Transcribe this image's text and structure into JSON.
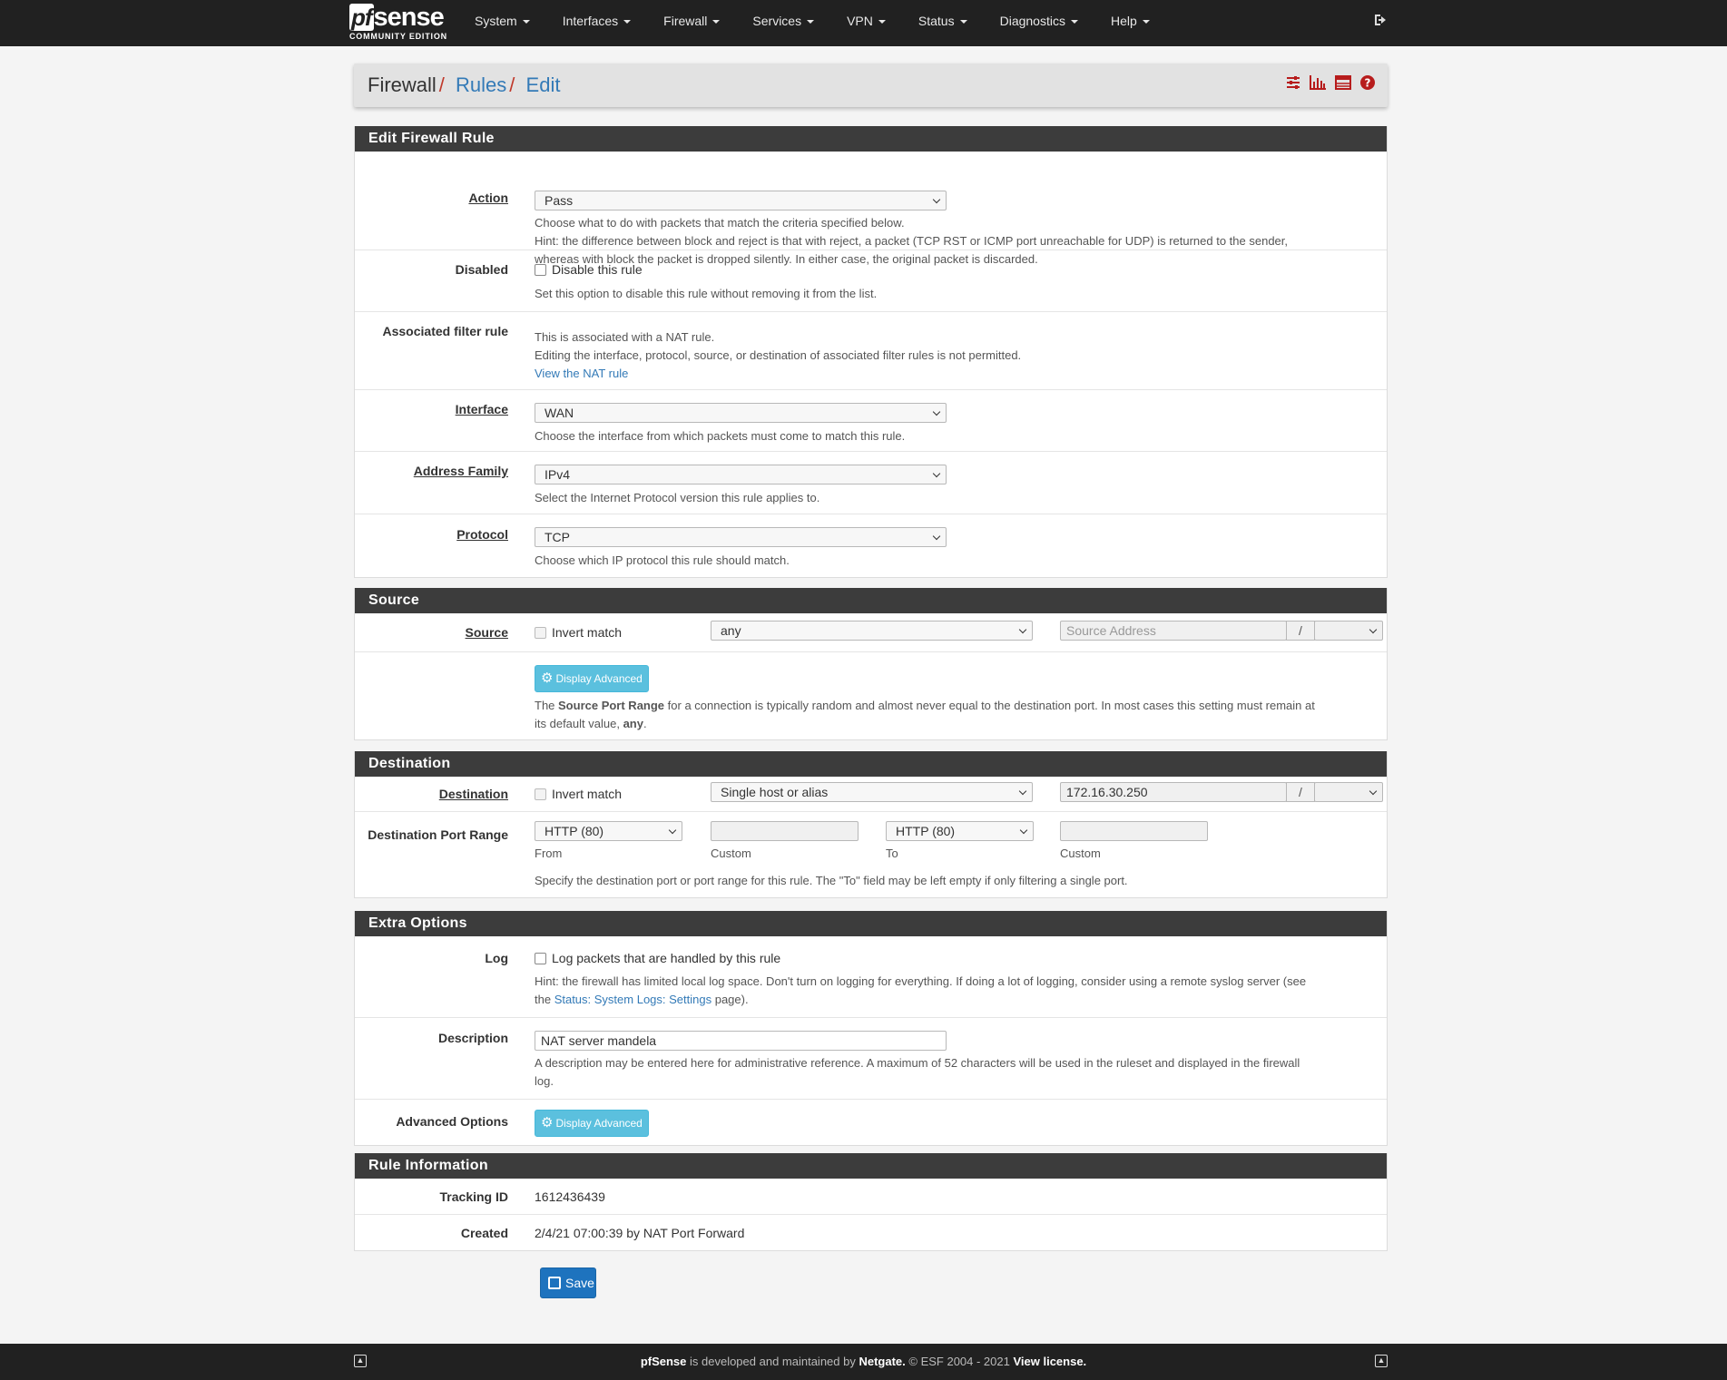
{
  "brand": {
    "logo_pf": "pf",
    "logo_sense": "sense",
    "edition": "COMMUNITY EDITION"
  },
  "nav": {
    "items": [
      {
        "label": "System"
      },
      {
        "label": "Interfaces"
      },
      {
        "label": "Firewall"
      },
      {
        "label": "Services"
      },
      {
        "label": "VPN"
      },
      {
        "label": "Status"
      },
      {
        "label": "Diagnostics"
      },
      {
        "label": "Help"
      }
    ]
  },
  "breadcrumb": {
    "root": "Firewall",
    "sep1": "/",
    "rules": "Rules",
    "sep2": "/",
    "edit": "Edit"
  },
  "header_icons": [
    "sliders-icon",
    "bar-chart-icon",
    "table-icon",
    "help-icon"
  ],
  "edit_rule": {
    "title": "Edit Firewall Rule",
    "action": {
      "label": "Action",
      "value": "Pass",
      "help1": "Choose what to do with packets that match the criteria specified below.",
      "help2": "Hint: the difference between block and reject is that with reject, a packet (TCP RST or ICMP port unreachable for UDP) is returned to the sender,",
      "help3": "whereas with block the packet is dropped silently. In either case, the original packet is discarded."
    },
    "disabled": {
      "label": "Disabled",
      "checkbox_label": "Disable this rule",
      "help": "Set this option to disable this rule without removing it from the list."
    },
    "assoc": {
      "label": "Associated filter rule",
      "line1": "This is associated with a NAT rule.",
      "line2": "Editing the interface, protocol, source, or destination of associated filter rules is not permitted.",
      "link": "View the NAT rule"
    },
    "interface": {
      "label": "Interface",
      "value": "WAN",
      "help": "Choose the interface from which packets must come to match this rule."
    },
    "family": {
      "label": "Address Family",
      "value": "IPv4",
      "help": "Select the Internet Protocol version this rule applies to."
    },
    "protocol": {
      "label": "Protocol",
      "value": "TCP",
      "help": "Choose which IP protocol this rule should match."
    }
  },
  "source": {
    "title": "Source",
    "label": "Source",
    "invert": "Invert match",
    "type": "any",
    "address_placeholder": "Source Address",
    "slash": "/",
    "advanced_btn": "Display Advanced",
    "help_pre": "The ",
    "help_bold": "Source Port Range",
    "help_mid": " for a connection is typically random and almost never equal to the destination port. In most cases this setting must remain at",
    "help_line2_pre": "its default value, ",
    "help_line2_bold": "any",
    "help_line2_post": "."
  },
  "destination": {
    "title": "Destination",
    "label": "Destination",
    "invert": "Invert match",
    "type": "Single host or alias",
    "address": "172.16.30.250",
    "slash": "/",
    "port_label": "Destination Port Range",
    "from_value": "HTTP (80)",
    "to_value": "HTTP (80)",
    "from_caption": "From",
    "custom_caption": "Custom",
    "to_caption": "To",
    "custom2_caption": "Custom",
    "help": "Specify the destination port or port range for this rule. The \"To\" field may be left empty if only filtering a single port."
  },
  "extra": {
    "title": "Extra Options",
    "log_label": "Log",
    "log_checkbox": "Log packets that are handled by this rule",
    "log_help1": "Hint: the firewall has limited local log space. Don't turn on logging for everything. If doing a lot of logging, consider using a remote syslog server (see",
    "log_help2_pre": "the ",
    "log_help2_link": "Status: System Logs: Settings",
    "log_help2_post": " page).",
    "desc_label": "Description",
    "desc_value": "NAT server mandela",
    "desc_help1": "A description may be entered here for administrative reference. A maximum of 52 characters will be used in the ruleset and displayed in the firewall",
    "desc_help2": "log.",
    "adv_label": "Advanced Options",
    "adv_btn": "Display Advanced"
  },
  "rule_info": {
    "title": "Rule Information",
    "tracking_label": "Tracking ID",
    "tracking_value": "1612436439",
    "created_label": "Created",
    "created_value": "2/4/21 07:00:39 by NAT Port Forward"
  },
  "save_label": "Save",
  "footer": {
    "product": "pfSense",
    "text1": " is developed and maintained by ",
    "company": "Netgate.",
    "text2": " © ESF 2004 - 2021 ",
    "license": "View license."
  }
}
